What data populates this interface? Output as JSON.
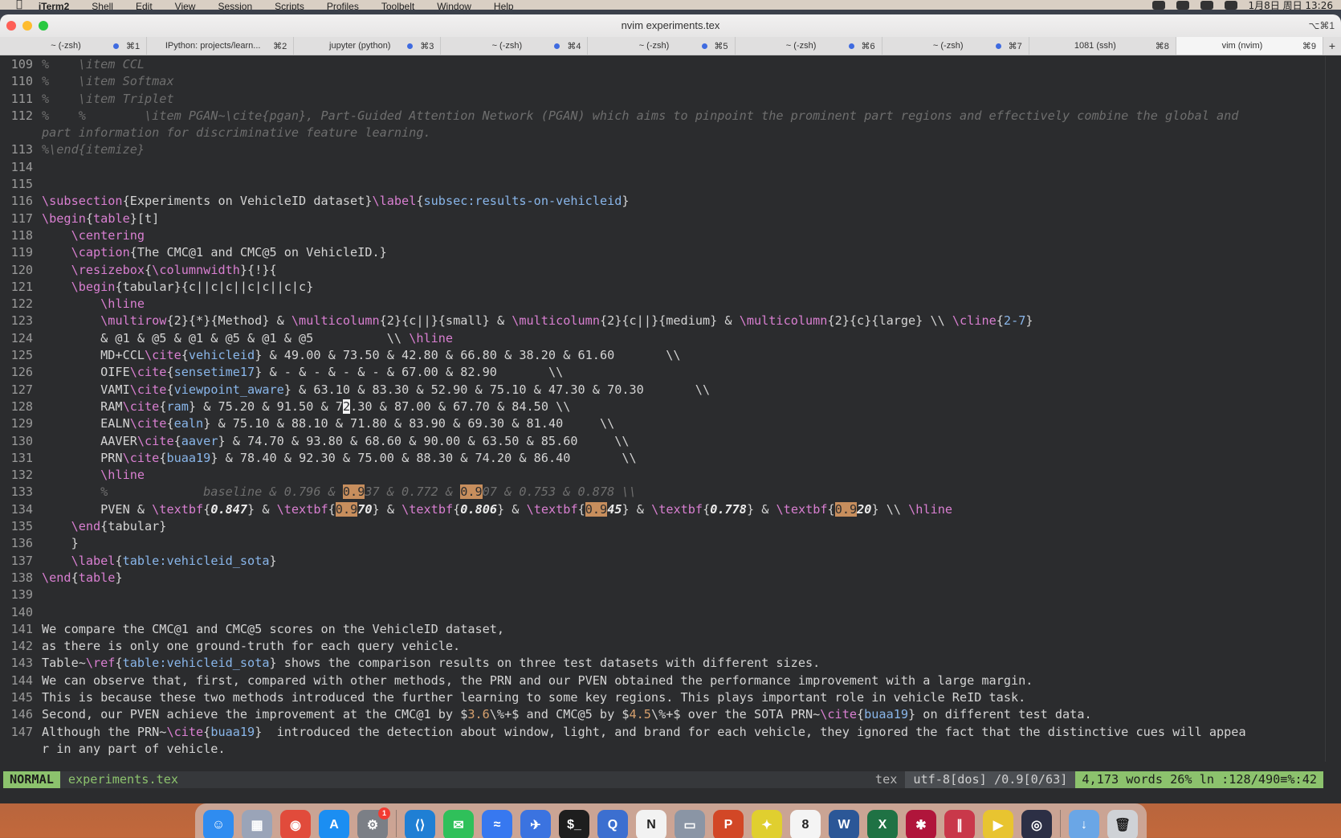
{
  "menubar": {
    "apple": "",
    "items": [
      "iTerm2",
      "Shell",
      "Edit",
      "View",
      "Session",
      "Scripts",
      "Profiles",
      "Toolbelt",
      "Window",
      "Help"
    ],
    "clock": "1月8日 周日 13:26"
  },
  "window": {
    "title": "nvim experiments.tex",
    "title_shortcut": "⌥⌘1"
  },
  "tabs": [
    {
      "label": "~ (-zsh)",
      "shortcut": "⌘1",
      "dot": true,
      "active": false
    },
    {
      "label": "IPython: projects/learn...",
      "shortcut": "⌘2",
      "dot": false,
      "active": false
    },
    {
      "label": "jupyter (python)",
      "shortcut": "⌘3",
      "dot": true,
      "active": false
    },
    {
      "label": "~ (-zsh)",
      "shortcut": "⌘4",
      "dot": true,
      "active": false
    },
    {
      "label": "~ (-zsh)",
      "shortcut": "⌘5",
      "dot": true,
      "active": false
    },
    {
      "label": "~ (-zsh)",
      "shortcut": "⌘6",
      "dot": true,
      "active": false
    },
    {
      "label": "~ (-zsh)",
      "shortcut": "⌘7",
      "dot": true,
      "active": false
    },
    {
      "label": "1081 (ssh)",
      "shortcut": "⌘8",
      "dot": false,
      "active": false
    },
    {
      "label": "vim (nvim)",
      "shortcut": "⌘9",
      "dot": false,
      "active": true
    }
  ],
  "editor": {
    "lines": [
      {
        "n": "109",
        "segs": [
          [
            "com",
            "%    \\item CCL"
          ]
        ]
      },
      {
        "n": "110",
        "segs": [
          [
            "com",
            "%    \\item Softmax"
          ]
        ]
      },
      {
        "n": "111",
        "segs": [
          [
            "com",
            "%    \\item Triplet"
          ]
        ]
      },
      {
        "n": "112",
        "segs": [
          [
            "com",
            "%    %        \\item PGAN~\\cite{pgan}, Part-Guided Attention Network (PGAN) which aims to pinpoint the prominent part regions and effectively combine the global and"
          ]
        ]
      },
      {
        "n": "",
        "segs": [
          [
            "com",
            "part information for discriminative feature learning."
          ]
        ]
      },
      {
        "n": "113",
        "segs": [
          [
            "com",
            "%\\end{itemize}"
          ]
        ]
      },
      {
        "n": "114",
        "segs": []
      },
      {
        "n": "115",
        "segs": []
      },
      {
        "n": "116",
        "segs": [
          [
            "cmd",
            "\\subsection"
          ],
          [
            "txt",
            "{Experiments on VehicleID dataset}"
          ],
          [
            "cmd",
            "\\label"
          ],
          [
            "txt",
            "{"
          ],
          [
            "arg",
            "subsec:results-on-vehicleid"
          ],
          [
            "txt",
            "}"
          ]
        ]
      },
      {
        "n": "117",
        "segs": [
          [
            "cmd",
            "\\begin"
          ],
          [
            "txt",
            "{"
          ],
          [
            "cmd",
            "table"
          ],
          [
            "txt",
            "}[t]"
          ]
        ]
      },
      {
        "n": "118",
        "segs": [
          [
            "txt",
            "    "
          ],
          [
            "cmd",
            "\\centering"
          ]
        ]
      },
      {
        "n": "119",
        "segs": [
          [
            "txt",
            "    "
          ],
          [
            "cmd",
            "\\caption"
          ],
          [
            "txt",
            "{The CMC@1 and CMC@5 on VehicleID.}"
          ]
        ]
      },
      {
        "n": "120",
        "segs": [
          [
            "txt",
            "    "
          ],
          [
            "cmd",
            "\\resizebox"
          ],
          [
            "txt",
            "{"
          ],
          [
            "cmd",
            "\\columnwidth"
          ],
          [
            "txt",
            "}{!}{"
          ]
        ]
      },
      {
        "n": "121",
        "segs": [
          [
            "txt",
            "    "
          ],
          [
            "cmd",
            "\\begin"
          ],
          [
            "txt",
            "{tabular}{c||c|c||c|c||c|c}"
          ]
        ]
      },
      {
        "n": "122",
        "segs": [
          [
            "txt",
            "        "
          ],
          [
            "cmd",
            "\\hline"
          ]
        ]
      },
      {
        "n": "123",
        "segs": [
          [
            "txt",
            "        "
          ],
          [
            "cmd",
            "\\multirow"
          ],
          [
            "txt",
            "{2}{*}{Method} & "
          ],
          [
            "cmd",
            "\\multicolumn"
          ],
          [
            "txt",
            "{2}{c||}{small} & "
          ],
          [
            "cmd",
            "\\multicolumn"
          ],
          [
            "txt",
            "{2}{c||}{medium} & "
          ],
          [
            "cmd",
            "\\multicolumn"
          ],
          [
            "txt",
            "{2}{c}{large} \\\\ "
          ],
          [
            "cmd",
            "\\cline"
          ],
          [
            "txt",
            "{"
          ],
          [
            "arg",
            "2-7"
          ],
          [
            "txt",
            "}"
          ]
        ]
      },
      {
        "n": "124",
        "segs": [
          [
            "txt",
            "        & @1 & @5 & @1 & @5 & @1 & @5          \\\\ "
          ],
          [
            "cmd",
            "\\hline"
          ]
        ]
      },
      {
        "n": "125",
        "segs": [
          [
            "txt",
            "        MD+CCL"
          ],
          [
            "cmd",
            "\\cite"
          ],
          [
            "txt",
            "{"
          ],
          [
            "arg",
            "vehicleid"
          ],
          [
            "txt",
            "} & 49.00 & 73.50 & 42.80 & 66.80 & 38.20 & 61.60       \\\\"
          ]
        ]
      },
      {
        "n": "126",
        "segs": [
          [
            "txt",
            "        OIFE"
          ],
          [
            "cmd",
            "\\cite"
          ],
          [
            "txt",
            "{"
          ],
          [
            "arg",
            "sensetime17"
          ],
          [
            "txt",
            "} & - & - & - & - & 67.00 & 82.90       \\\\"
          ]
        ]
      },
      {
        "n": "127",
        "segs": [
          [
            "txt",
            "        VAMI"
          ],
          [
            "cmd",
            "\\cite"
          ],
          [
            "txt",
            "{"
          ],
          [
            "arg",
            "viewpoint_aware"
          ],
          [
            "txt",
            "} & 63.10 & 83.30 & 52.90 & 75.10 & 47.30 & 70.30       \\\\"
          ]
        ]
      },
      {
        "n": "128",
        "segs": [
          [
            "txt",
            "        RAM"
          ],
          [
            "cmd",
            "\\cite"
          ],
          [
            "txt",
            "{"
          ],
          [
            "arg",
            "ram"
          ],
          [
            "txt",
            "} & 75.20 & 91.50 & 7"
          ],
          [
            "cursor",
            "2"
          ],
          [
            "txt",
            ".30 & 87.00 & 67.70 & 84.50 \\\\"
          ]
        ]
      },
      {
        "n": "129",
        "segs": [
          [
            "txt",
            "        EALN"
          ],
          [
            "cmd",
            "\\cite"
          ],
          [
            "txt",
            "{"
          ],
          [
            "arg",
            "ealn"
          ],
          [
            "txt",
            "} & 75.10 & 88.10 & 71.80 & 83.90 & 69.30 & 81.40     \\\\"
          ]
        ]
      },
      {
        "n": "130",
        "segs": [
          [
            "txt",
            "        AAVER"
          ],
          [
            "cmd",
            "\\cite"
          ],
          [
            "txt",
            "{"
          ],
          [
            "arg",
            "aaver"
          ],
          [
            "txt",
            "} & 74.70 & 93.80 & 68.60 & 90.00 & 63.50 & 85.60     \\\\"
          ]
        ]
      },
      {
        "n": "131",
        "segs": [
          [
            "txt",
            "        PRN"
          ],
          [
            "cmd",
            "\\cite"
          ],
          [
            "txt",
            "{"
          ],
          [
            "arg",
            "buaa19"
          ],
          [
            "txt",
            "} & 78.40 & 92.30 & 75.00 & 88.30 & 74.20 & 86.40       \\\\"
          ]
        ]
      },
      {
        "n": "132",
        "segs": [
          [
            "txt",
            "        "
          ],
          [
            "cmd",
            "\\hline"
          ]
        ]
      },
      {
        "n": "133",
        "segs": [
          [
            "txt",
            "        "
          ],
          [
            "com",
            "%             baseline & 0.796 & "
          ],
          [
            "hl",
            "0.9"
          ],
          [
            "com",
            "37 & 0.772 & "
          ],
          [
            "hl",
            "0.9"
          ],
          [
            "com",
            "07 & 0.753 & 0.878 \\\\"
          ]
        ]
      },
      {
        "n": "134",
        "segs": [
          [
            "txt",
            "        PVEN & "
          ],
          [
            "cmd",
            "\\textbf"
          ],
          [
            "txt",
            "{"
          ],
          [
            "bold",
            "0.847"
          ],
          [
            "txt",
            "} & "
          ],
          [
            "cmd",
            "\\textbf"
          ],
          [
            "txt",
            "{"
          ],
          [
            "hl",
            "0.9"
          ],
          [
            "bold",
            "70"
          ],
          [
            "txt",
            "} & "
          ],
          [
            "cmd",
            "\\textbf"
          ],
          [
            "txt",
            "{"
          ],
          [
            "bold",
            "0.806"
          ],
          [
            "txt",
            "} & "
          ],
          [
            "cmd",
            "\\textbf"
          ],
          [
            "txt",
            "{"
          ],
          [
            "hl",
            "0.9"
          ],
          [
            "bold",
            "45"
          ],
          [
            "txt",
            "} & "
          ],
          [
            "cmd",
            "\\textbf"
          ],
          [
            "txt",
            "{"
          ],
          [
            "bold",
            "0.778"
          ],
          [
            "txt",
            "} & "
          ],
          [
            "cmd",
            "\\textbf"
          ],
          [
            "txt",
            "{"
          ],
          [
            "hl",
            "0.9"
          ],
          [
            "bold",
            "20"
          ],
          [
            "txt",
            "} \\\\ "
          ],
          [
            "cmd",
            "\\hline"
          ]
        ]
      },
      {
        "n": "135",
        "segs": [
          [
            "txt",
            "    "
          ],
          [
            "cmd",
            "\\end"
          ],
          [
            "txt",
            "{tabular}"
          ]
        ]
      },
      {
        "n": "136",
        "segs": [
          [
            "txt",
            "    }"
          ]
        ]
      },
      {
        "n": "137",
        "segs": [
          [
            "txt",
            "    "
          ],
          [
            "cmd",
            "\\label"
          ],
          [
            "txt",
            "{"
          ],
          [
            "arg",
            "table:vehicleid_sota"
          ],
          [
            "txt",
            "}"
          ]
        ]
      },
      {
        "n": "138",
        "segs": [
          [
            "cmd",
            "\\end"
          ],
          [
            "txt",
            "{"
          ],
          [
            "cmd",
            "table"
          ],
          [
            "txt",
            "}"
          ]
        ]
      },
      {
        "n": "139",
        "segs": []
      },
      {
        "n": "140",
        "segs": []
      },
      {
        "n": "141",
        "segs": [
          [
            "txt",
            "We compare the CMC@1 and CMC@5 scores on the VehicleID dataset,"
          ]
        ]
      },
      {
        "n": "142",
        "segs": [
          [
            "txt",
            "as there is only one ground-truth for each query vehicle."
          ]
        ]
      },
      {
        "n": "143",
        "segs": [
          [
            "txt",
            "Table~"
          ],
          [
            "cmd",
            "\\ref"
          ],
          [
            "txt",
            "{"
          ],
          [
            "arg",
            "table:vehicleid_sota"
          ],
          [
            "txt",
            "} shows the comparison results on three test datasets with different sizes."
          ]
        ]
      },
      {
        "n": "144",
        "segs": [
          [
            "txt",
            "We can observe that, first, compared with other methods, the PRN and our PVEN obtained the performance improvement with a large margin."
          ]
        ]
      },
      {
        "n": "145",
        "segs": [
          [
            "txt",
            "This is because these two methods introduced the further learning to some key regions. This plays important role in vehicle ReID task."
          ]
        ]
      },
      {
        "n": "146",
        "segs": [
          [
            "txt",
            "Second, our PVEN achieve the improvement at the CMC@1 by $"
          ],
          [
            "num",
            "3.6"
          ],
          [
            "txt",
            "\\%+$ and CMC@5 by $"
          ],
          [
            "num",
            "4.5"
          ],
          [
            "txt",
            "\\%+$ over the SOTA PRN~"
          ],
          [
            "cmd",
            "\\cite"
          ],
          [
            "txt",
            "{"
          ],
          [
            "arg",
            "buaa19"
          ],
          [
            "txt",
            "} on different test data."
          ]
        ]
      },
      {
        "n": "147",
        "segs": [
          [
            "txt",
            "Although the PRN~"
          ],
          [
            "cmd",
            "\\cite"
          ],
          [
            "txt",
            "{"
          ],
          [
            "arg",
            "buaa19"
          ],
          [
            "txt",
            "}  introduced the detection about window, light, and brand for each vehicle, they ignored the fact that the distinctive cues will appea"
          ]
        ]
      },
      {
        "n": "",
        "segs": [
          [
            "txt",
            "r in any part of vehicle."
          ]
        ]
      }
    ]
  },
  "statusline": {
    "mode": "NORMAL",
    "file": "experiments.tex",
    "filetype": "tex",
    "encoding": "utf-8[dos] /0.9[0/63]",
    "position": "4,173 words 26% ln :128/490≡%:42"
  },
  "dock": {
    "apps": [
      {
        "name": "finder-icon",
        "glyph": "☺",
        "color": "#2f8cf0"
      },
      {
        "name": "launchpad-icon",
        "glyph": "▦",
        "color": "#9aa4b8"
      },
      {
        "name": "chrome-icon",
        "glyph": "◉",
        "color": "#e14b3b"
      },
      {
        "name": "app-store-icon",
        "glyph": "A",
        "color": "#1b8ef2"
      },
      {
        "name": "system-settings-icon",
        "glyph": "⚙",
        "color": "#7b7f86",
        "badge": "1"
      },
      {
        "name": "sep"
      },
      {
        "name": "vscode-icon",
        "glyph": "⟨⟩",
        "color": "#1f7fd4"
      },
      {
        "name": "wechat-icon",
        "glyph": "✉",
        "color": "#2fc05a"
      },
      {
        "name": "feishu-icon",
        "glyph": "≈",
        "color": "#3778f0"
      },
      {
        "name": "mail-bird-icon",
        "glyph": "✈",
        "color": "#3b73e0"
      },
      {
        "name": "terminal-icon",
        "glyph": "$_",
        "color": "#1e1e1e"
      },
      {
        "name": "alfred-icon",
        "glyph": "Q",
        "color": "#3c6fd0"
      },
      {
        "name": "notion-icon",
        "glyph": "N",
        "color": "#f2f2f2"
      },
      {
        "name": "preview-icon",
        "glyph": "▭",
        "color": "#8a95a5"
      },
      {
        "name": "powerpoint-icon",
        "glyph": "P",
        "color": "#d24726"
      },
      {
        "name": "mindnode-icon",
        "glyph": "✦",
        "color": "#e0cf2f"
      },
      {
        "name": "calendar-icon",
        "glyph": "8",
        "color": "#f4f4f4"
      },
      {
        "name": "word-icon",
        "glyph": "W",
        "color": "#2b5797"
      },
      {
        "name": "excel-icon",
        "glyph": "X",
        "color": "#1f7244"
      },
      {
        "name": "mendeley-icon",
        "glyph": "✱",
        "color": "#b0153b"
      },
      {
        "name": "parallels-icon",
        "glyph": "∥",
        "color": "#c9384a"
      },
      {
        "name": "infuse-icon",
        "glyph": "▶",
        "color": "#e8c430"
      },
      {
        "name": "obs-icon",
        "glyph": "◎",
        "color": "#2c2f45"
      },
      {
        "name": "sep"
      },
      {
        "name": "downloads-icon",
        "glyph": "↓",
        "color": "#6aa6e6"
      },
      {
        "name": "trash-icon",
        "glyph": "🗑",
        "color": "#cfd2d6"
      }
    ]
  }
}
